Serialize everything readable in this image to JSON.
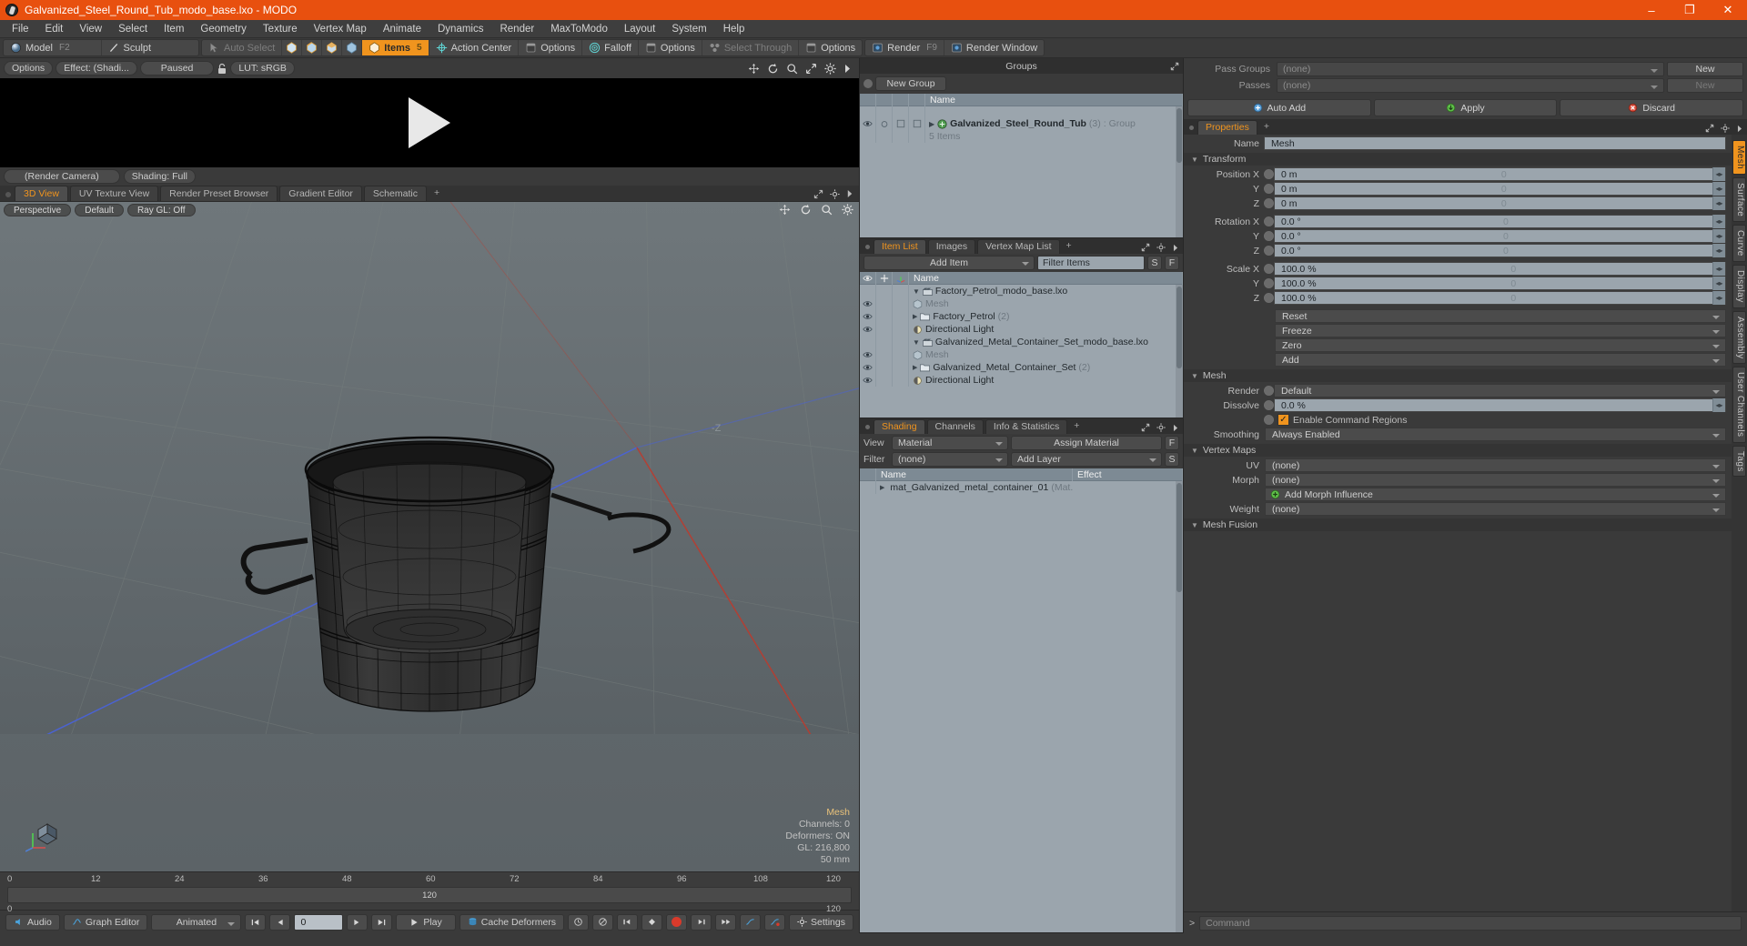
{
  "titlebar": {
    "title": "Galvanized_Steel_Round_Tub_modo_base.lxo - MODO",
    "minimize": "–",
    "maximize": "❐",
    "close": "✕"
  },
  "menubar": {
    "items": [
      "File",
      "Edit",
      "View",
      "Select",
      "Item",
      "Geometry",
      "Texture",
      "Vertex Map",
      "Animate",
      "Dynamics",
      "Render",
      "MaxToModo",
      "Layout",
      "System",
      "Help"
    ]
  },
  "toolbar": {
    "mode": {
      "model": "Model",
      "model_hk": "F2",
      "sculpt": "Sculpt"
    },
    "select": {
      "auto_select": "Auto Select",
      "items": "Items",
      "items_hk": "5",
      "action_center": "Action Center",
      "options1": "Options",
      "falloff": "Falloff",
      "options2": "Options",
      "select_through": "Select Through",
      "options3": "Options"
    },
    "render": {
      "render": "Render",
      "render_hk": "F9",
      "render_window": "Render Window"
    }
  },
  "render_pane": {
    "options": "Options",
    "effect": "Effect: (Shadi...",
    "paused": "Paused",
    "lut": "LUT: sRGB",
    "camera": "(Render Camera)",
    "shading": "Shading: Full"
  },
  "viewport_tabs": {
    "tabs": [
      "3D View",
      "UV Texture View",
      "Render Preset Browser",
      "Gradient Editor",
      "Schematic"
    ],
    "selected": "3D View",
    "add": "+"
  },
  "viewport": {
    "perspective": "Perspective",
    "preset": "Default",
    "raygl": "Ray GL: Off",
    "axis_label": "-Z",
    "stats": {
      "title": "Mesh",
      "channels": "Channels: 0",
      "deformers": "Deformers: ON",
      "gl": "GL: 216,800",
      "scale": "50 mm"
    }
  },
  "timeline": {
    "ticks": [
      "0",
      "12",
      "24",
      "36",
      "48",
      "60",
      "72",
      "84",
      "96",
      "108",
      "120"
    ],
    "center": "120",
    "start": "0",
    "end": "120"
  },
  "bottombar": {
    "audio": "Audio",
    "graph_editor": "Graph Editor",
    "animated": "Animated",
    "frame": "0",
    "play": "Play",
    "cache_deformers": "Cache Deformers",
    "settings": "Settings"
  },
  "groups_panel": {
    "title": "Groups",
    "new_group": "New Group",
    "columns": [
      "Name"
    ],
    "rows": [
      {
        "name": "Galvanized_Steel_Round_Tub",
        "count": "(3)",
        "type": ": Group",
        "sub": "5 Items"
      }
    ]
  },
  "item_list_panel": {
    "tabs": [
      "Item List",
      "Images",
      "Vertex Map List"
    ],
    "selected": "Item List",
    "add": "+",
    "add_item": "Add Item",
    "filter_placeholder": "Filter Items",
    "filter_s": "S",
    "filter_f": "F",
    "columns": [
      "Name"
    ],
    "rows": [
      {
        "name": "Factory_Petrol_modo_base.lxo",
        "count": "",
        "indent": 0,
        "icon": "scene-icon",
        "dim": false
      },
      {
        "name": "Mesh",
        "count": "",
        "indent": 1,
        "icon": "mesh-icon",
        "dim": true
      },
      {
        "name": "Factory_Petrol",
        "count": "(2)",
        "indent": 1,
        "icon": "group-icon",
        "dim": false
      },
      {
        "name": "Directional Light",
        "count": "",
        "indent": 1,
        "icon": "light-icon",
        "dim": false
      },
      {
        "name": "Galvanized_Metal_Container_Set_modo_base.lxo",
        "count": "",
        "indent": 0,
        "icon": "scene-icon",
        "dim": false
      },
      {
        "name": "Mesh",
        "count": "",
        "indent": 1,
        "icon": "mesh-icon",
        "dim": true
      },
      {
        "name": "Galvanized_Metal_Container_Set",
        "count": "(2)",
        "indent": 1,
        "icon": "group-icon",
        "dim": false
      },
      {
        "name": "Directional Light",
        "count": "",
        "indent": 1,
        "icon": "light-icon",
        "dim": false
      }
    ]
  },
  "shading_panel": {
    "tabs": [
      "Shading",
      "Channels",
      "Info & Statistics"
    ],
    "selected": "Shading",
    "add": "+",
    "view_label": "View",
    "view_value": "Material",
    "assign_material": "Assign Material",
    "assign_f": "F",
    "filter_label": "Filter",
    "filter_value": "(none)",
    "add_layer": "Add Layer",
    "add_layer_s": "S",
    "columns": [
      "Name",
      "Effect"
    ],
    "rows": [
      {
        "name": "mat_Galvanized_metal_container_01",
        "suffix": "(Mat...",
        "effect": ""
      }
    ]
  },
  "passes": {
    "pass_groups_label": "Pass Groups",
    "pass_groups_value": "(none)",
    "pass_groups_new": "New",
    "passes_label": "Passes",
    "passes_value": "(none)",
    "passes_new": "New",
    "auto_add": "Auto Add",
    "apply": "Apply",
    "discard": "Discard"
  },
  "properties": {
    "tabs": [
      "Properties"
    ],
    "selected": "Properties",
    "add": "+",
    "name_label": "Name",
    "name_value": "Mesh",
    "transform_header": "Transform",
    "transform_rows": [
      {
        "label": "Position X",
        "value": "0 m"
      },
      {
        "label": "Y",
        "value": "0 m"
      },
      {
        "label": "Z",
        "value": "0 m"
      },
      {
        "label": "Rotation X",
        "value": "0.0 °"
      },
      {
        "label": "Y",
        "value": "0.0 °"
      },
      {
        "label": "Z",
        "value": "0.0 °"
      },
      {
        "label": "Scale X",
        "value": "100.0 %"
      },
      {
        "label": "Y",
        "value": "100.0 %"
      },
      {
        "label": "Z",
        "value": "100.0 %"
      }
    ],
    "transform_actions": [
      "Reset",
      "Freeze",
      "Zero",
      "Add"
    ],
    "mesh_header": "Mesh",
    "render_label": "Render",
    "render_value": "Default",
    "dissolve_label": "Dissolve",
    "dissolve_value": "0.0 %",
    "enable_command_regions": "Enable Command Regions",
    "smoothing_label": "Smoothing",
    "smoothing_value": "Always Enabled",
    "vertex_maps_header": "Vertex Maps",
    "uv_label": "UV",
    "uv_value": "(none)",
    "morph_label": "Morph",
    "morph_value": "(none)",
    "add_morph_influence": "Add Morph Influence",
    "weight_label": "Weight",
    "weight_value": "(none)",
    "mesh_fusion_header": "Mesh Fusion",
    "side_tabs": [
      "Mesh",
      "Surface",
      "Curve",
      "Display",
      "Assembly",
      "User Channels",
      "Tags"
    ],
    "side_selected": "Mesh"
  },
  "command_bar": {
    "prompt": ">",
    "placeholder": "Command"
  },
  "colors": {
    "title_bar": "#e8500f",
    "accent": "#f0941e",
    "panel_bg": "#3a3a3a",
    "list_bg": "#9ba5ad",
    "viewport_bg": "#636a6e"
  }
}
